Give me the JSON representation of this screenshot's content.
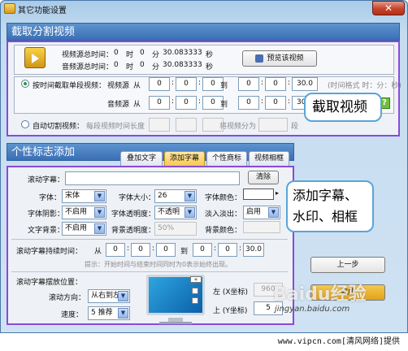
{
  "window": {
    "title": "其它功能设置",
    "close_symbol": "✕"
  },
  "capture": {
    "header": "截取分割视频",
    "video_total_label": "视频源总时间：",
    "audio_total_label": "音频源总时间：",
    "video_total": [
      "0",
      "时",
      "0",
      "分",
      "30.083333",
      "秒"
    ],
    "audio_total": [
      "0",
      "时",
      "0",
      "分",
      "30.083333",
      "秒"
    ],
    "preview_button": "预览该视频",
    "time_mode_label": "按时间截取单段视频：",
    "video_source_label": "视频源",
    "audio_source_label": "音频源",
    "from": "从",
    "to": "到",
    "video_from": [
      "0",
      "0",
      "0"
    ],
    "video_to": [
      "0",
      "0",
      "30.0"
    ],
    "audio_from": [
      "0",
      "0",
      "0"
    ],
    "audio_to": [
      "0",
      "0",
      "30.0"
    ],
    "time_format_hint": "(时间格式 时：分：秒)",
    "auto_split_label": "自动切割视频：",
    "segment_length_label": "每段视频时间长度",
    "split_into_label": "将视频分为",
    "segments_unit": "段",
    "callout": "截取视频"
  },
  "logo": {
    "header": "个性标志添加",
    "tabs": [
      "叠加文字",
      "添加字幕",
      "个性商标",
      "视频相框"
    ],
    "active_tab": 1,
    "scroll_subtitle_label": "滚动字幕：",
    "scroll_subtitle_value": "",
    "clear_button": "清除",
    "font_label": "字体：",
    "font_value": "宋体",
    "font_size_label": "字体大小：",
    "font_size_value": "26",
    "font_color_label": "字体颜色：",
    "font_color": "#ffffff",
    "font_shadow_label": "字体阴影：",
    "font_shadow_value": "不启用",
    "font_opacity_label": "字体透明度：",
    "font_opacity_value": "不透明",
    "fade_label": "淡入淡出：",
    "fade_value": "启用",
    "text_bg_label": "文字背景：",
    "text_bg_value": "不启用",
    "bg_opacity_label": "背景透明度：",
    "bg_opacity_value": "50%",
    "bg_color_label": "背景颜色：",
    "duration_label": "滚动字幕持续时间：",
    "duration_from": [
      "0",
      "0",
      "0"
    ],
    "duration_to": [
      "0",
      "0",
      "30.0"
    ],
    "duration_hint": "提示：开始时间与结束时间同时为0表示始终出现。",
    "position_label": "滚动字幕摆放位置：",
    "direction_label": "滚动方向：",
    "direction_value": "从右到左",
    "speed_label": "速度：",
    "speed_value": "5 推荐",
    "left_label": "左 (X坐标)",
    "left_value": "960",
    "top_label": "上 (Y坐标)",
    "top_value": "5",
    "prev_button": "上一步",
    "next_button": "完成",
    "callout": "添加字幕、水印、相框"
  },
  "watermark_site": "Baidu经验",
  "watermark_url": "jingyan.baidu.com",
  "footer_text": "www.vipcn.com[清风网络]提供"
}
